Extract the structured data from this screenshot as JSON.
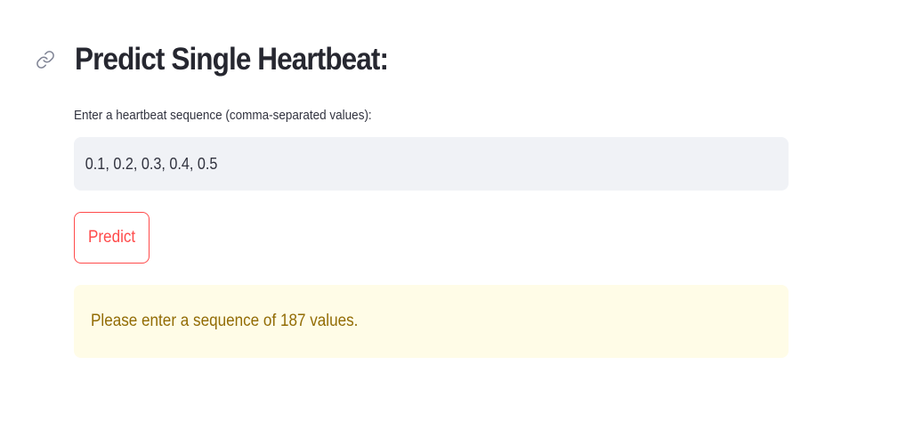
{
  "header": {
    "title": "Predict Single Heartbeat:",
    "anchor_icon": "link-icon"
  },
  "form": {
    "label": "Enter a heartbeat sequence (comma-separated values):",
    "input_value": "0.1, 0.2, 0.3, 0.4, 0.5",
    "button_label": "Predict"
  },
  "alert": {
    "type": "warning",
    "message": "Please enter a sequence of 187 values."
  },
  "colors": {
    "accent": "#ff4b4b",
    "input_background": "#f0f2f6",
    "warning_background": "#fffce7",
    "warning_text": "#926c05",
    "text": "#31333f"
  }
}
